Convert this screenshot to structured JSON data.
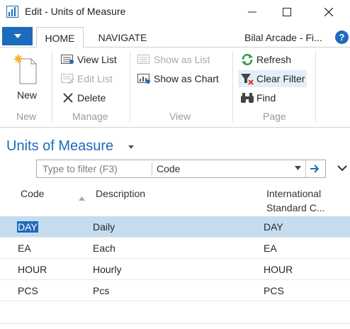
{
  "window": {
    "title": "Edit - Units of Measure"
  },
  "tabs": {
    "home": "HOME",
    "navigate": "NAVIGATE",
    "company": "Bilal Arcade - Fi..."
  },
  "ribbon": {
    "new_label": "New",
    "view_list": "View List",
    "edit_list": "Edit List",
    "delete": "Delete",
    "show_as_list": "Show as List",
    "show_as_chart": "Show as Chart",
    "refresh": "Refresh",
    "clear_filter": "Clear Filter",
    "find": "Find",
    "groups": {
      "new": "New",
      "manage": "Manage",
      "view": "View",
      "page": "Page"
    }
  },
  "page": {
    "title": "Units of Measure"
  },
  "filter": {
    "placeholder": "Type to filter (F3)",
    "field": "Code"
  },
  "table": {
    "columns": {
      "code": "Code",
      "description": "Description",
      "intl_line1": "International",
      "intl_line2": "Standard C..."
    },
    "rows": [
      {
        "code": "DAY",
        "description": "Daily",
        "intl": "DAY"
      },
      {
        "code": "EA",
        "description": "Each",
        "intl": "EA"
      },
      {
        "code": "HOUR",
        "description": "Hourly",
        "intl": "HOUR"
      },
      {
        "code": "PCS",
        "description": "Pcs",
        "intl": "PCS"
      }
    ]
  },
  "colors": {
    "accent": "#1c6bbd",
    "selected_row": "#c5dcef"
  }
}
